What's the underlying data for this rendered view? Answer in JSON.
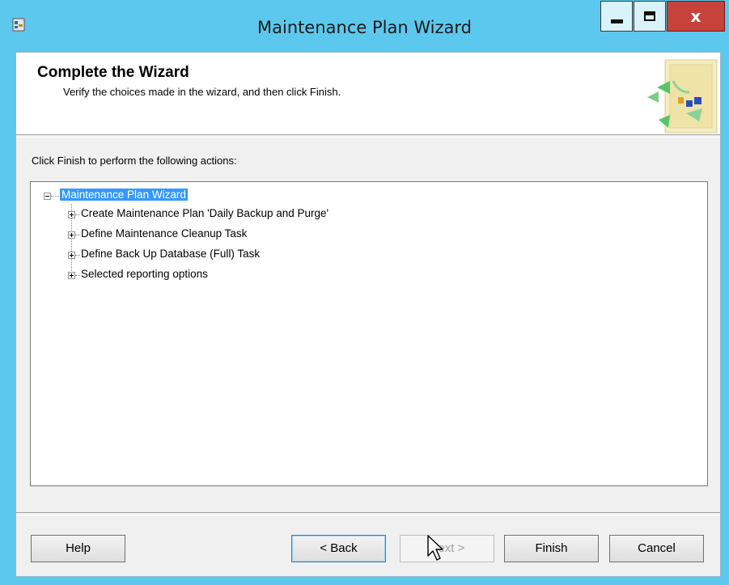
{
  "window": {
    "title": "Maintenance Plan Wizard",
    "close_glyph": "x",
    "icons": {
      "app": "wizard-app-icon",
      "minimize": "minimize-icon",
      "maximize": "maximize-icon",
      "close": "close-icon"
    }
  },
  "header": {
    "title": "Complete the Wizard",
    "subtitle": "Verify the choices made in the wizard, and then click Finish.",
    "graphic": "wizard-header-graphic"
  },
  "instruction": "Click Finish to perform the following actions:",
  "tree": {
    "root": {
      "label": "Maintenance Plan Wizard",
      "expanded": true,
      "selected": true
    },
    "children": [
      {
        "label": "Create Maintenance Plan 'Daily Backup and Purge'",
        "expanded": false
      },
      {
        "label": "Define Maintenance Cleanup Task",
        "expanded": false
      },
      {
        "label": "Define Back Up Database (Full) Task",
        "expanded": false
      },
      {
        "label": "Selected reporting options",
        "expanded": false
      }
    ]
  },
  "buttons": {
    "help": "Help",
    "back": "< Back",
    "next": "Next >",
    "finish": "Finish",
    "cancel": "Cancel"
  },
  "colors": {
    "frame": "#5cc8ee",
    "close_button": "#c7423a",
    "selection": "#3399ff"
  }
}
